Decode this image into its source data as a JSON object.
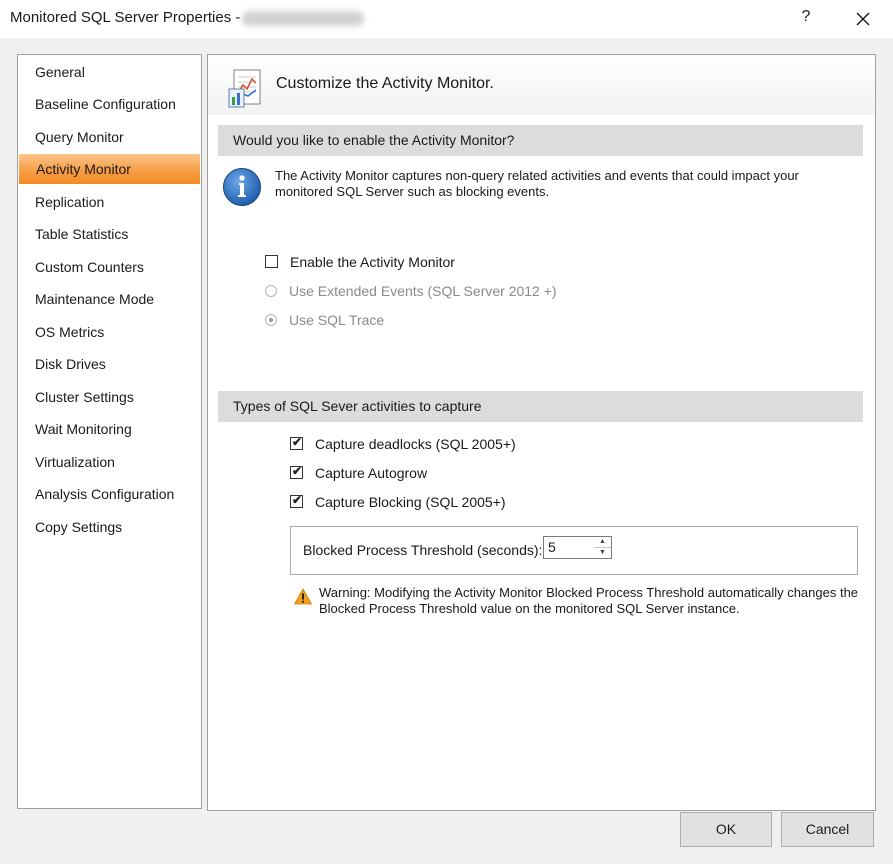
{
  "window": {
    "title": "Monitored SQL Server Properties -",
    "help_label": "?",
    "close_label": "close"
  },
  "nav": {
    "items": [
      {
        "label": "General"
      },
      {
        "label": "Baseline Configuration"
      },
      {
        "label": "Query Monitor"
      },
      {
        "label": "Activity Monitor",
        "selected": true
      },
      {
        "label": "Replication"
      },
      {
        "label": "Table Statistics"
      },
      {
        "label": "Custom Counters"
      },
      {
        "label": "Maintenance Mode"
      },
      {
        "label": "OS Metrics"
      },
      {
        "label": "Disk Drives"
      },
      {
        "label": "Cluster Settings"
      },
      {
        "label": "Wait Monitoring"
      },
      {
        "label": "Virtualization"
      },
      {
        "label": "Analysis Configuration"
      },
      {
        "label": "Copy Settings"
      }
    ]
  },
  "page": {
    "header": "Customize the Activity Monitor.",
    "section1": {
      "heading": "Would you like to enable the Activity Monitor?",
      "info": "The Activity Monitor captures non-query related activities and events that could impact your monitored SQL Server such as blocking events.",
      "enable_label": "Enable the Activity Monitor",
      "enable_checked": false,
      "radio_extended_label": "Use Extended Events (SQL Server 2012 +)",
      "radio_trace_label": "Use SQL Trace",
      "radio_selected": "trace"
    },
    "section2": {
      "heading": "Types of SQL Sever activities to capture",
      "deadlocks_label": "Capture deadlocks (SQL 2005+)",
      "deadlocks_checked": true,
      "autogrow_label": "Capture Autogrow",
      "autogrow_checked": true,
      "blocking_label": "Capture Blocking (SQL 2005+)",
      "blocking_checked": true,
      "threshold_label": "Blocked Process Threshold (seconds):",
      "threshold_value": "5",
      "warning": "Warning: Modifying the Activity Monitor Blocked Process Threshold automatically changes the Blocked Process Threshold value on the monitored SQL Server  instance."
    }
  },
  "buttons": {
    "ok": "OK",
    "cancel": "Cancel"
  },
  "colors": {
    "selected_nav": "#f59e46",
    "section_band": "#dcdcdc",
    "info_blue": "#1f5fae",
    "warning_amber": "#f0a020"
  }
}
